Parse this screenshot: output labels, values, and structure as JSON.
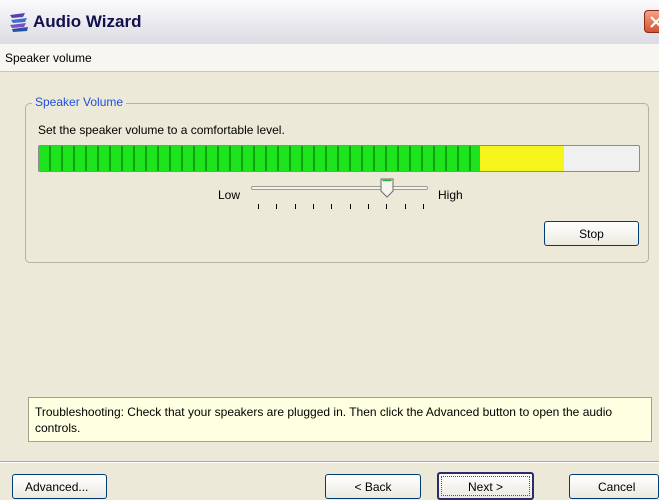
{
  "window": {
    "title": "Audio Wizard",
    "subtitle": "Speaker volume"
  },
  "group": {
    "legend": "Speaker Volume",
    "instruction": "Set the speaker volume to a comfortable level."
  },
  "meter": {
    "green_fraction": 0.735,
    "yellow_fraction": 0.14,
    "colors": {
      "green": "#1ee41e",
      "yellow": "#f5f51b",
      "empty": "#f0f0f0"
    }
  },
  "slider": {
    "low_label": "Low",
    "high_label": "High",
    "value_fraction": 0.78,
    "tick_count": 10
  },
  "buttons": {
    "stop": "Stop",
    "advanced": "Advanced...",
    "back": "< Back",
    "next": "Next >",
    "cancel": "Cancel"
  },
  "troubleshooting": "Troubleshooting: Check that your speakers are plugged in. Then click the Advanced button to open the audio controls."
}
